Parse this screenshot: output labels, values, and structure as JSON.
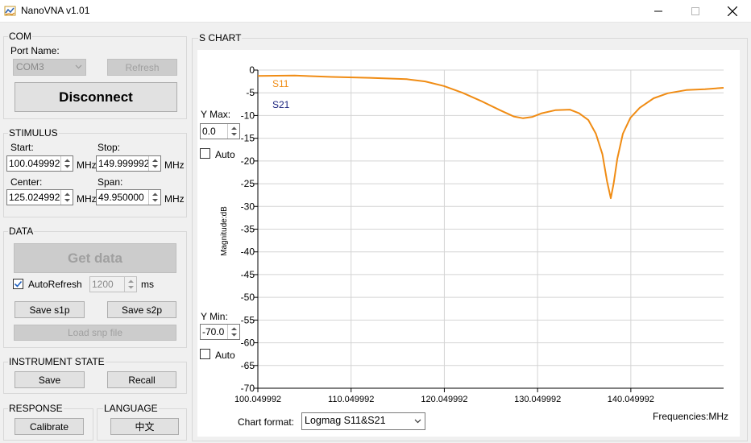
{
  "window": {
    "title": "NanoVNA v1.01"
  },
  "com": {
    "group_title": "COM",
    "port_label": "Port Name:",
    "port_value": "COM3",
    "refresh_label": "Refresh",
    "disconnect_label": "Disconnect"
  },
  "stimulus": {
    "group_title": "STIMULUS",
    "start_label": "Start:",
    "start_value": "100.049992",
    "stop_label": "Stop:",
    "stop_value": "149.999992",
    "center_label": "Center:",
    "center_value": "125.024992",
    "span_label": "Span:",
    "span_value": "49.950000",
    "unit": "MHz"
  },
  "data_group": {
    "group_title": "DATA",
    "get_data_label": "Get data",
    "autorefresh_label": "AutoRefresh",
    "autorefresh_checked": true,
    "interval_value": "1200",
    "interval_unit": "ms",
    "save_s1p_label": "Save s1p",
    "save_s2p_label": "Save s2p",
    "load_snp_label": "Load snp file"
  },
  "instrument_state": {
    "group_title": "INSTRUMENT STATE",
    "save_label": "Save",
    "recall_label": "Recall"
  },
  "response": {
    "group_title": "RESPONSE",
    "calibrate_label": "Calibrate"
  },
  "language": {
    "group_title": "LANGUAGE",
    "button_label": "中文"
  },
  "s_chart": {
    "group_title": "S CHART",
    "ymax_label": "Y Max:",
    "ymax_value": "0.0",
    "ymax_auto_label": "Auto",
    "ymin_label": "Y Min:",
    "ymin_value": "-70.0",
    "ymin_auto_label": "Auto",
    "chart_format_label": "Chart format:",
    "chart_format_value": "Logmag S11&S21",
    "frequency_units_label": "Frequencies:MHz"
  },
  "colors": {
    "s11": "#f08c14",
    "s21": "#1a237e",
    "window_bg": "#f0f0f0"
  },
  "icons": {
    "app": "nanovna-app-icon",
    "minimize": "minimize-icon",
    "maximize": "maximize-icon",
    "close": "close-icon"
  },
  "chart_data": {
    "type": "line",
    "ylabel": "Magnitude:dB",
    "xlabel": "Frequencies:MHz",
    "ylim": [
      -70,
      0
    ],
    "xlim": [
      100.049992,
      149.999992
    ],
    "y_ticks": [
      "0",
      "-5",
      "-10",
      "-15",
      "-20",
      "-25",
      "-30",
      "-35",
      "-40",
      "-45",
      "-50",
      "-55",
      "-60",
      "-65",
      "-70"
    ],
    "x_ticks": [
      "100.049992",
      "110.049992",
      "120.049992",
      "130.049992",
      "140.049992"
    ],
    "grid": true,
    "legend": [
      "S11",
      "S21"
    ],
    "series": [
      {
        "name": "S11",
        "x": [
          100.05,
          104,
          108,
          112,
          116,
          118,
          120,
          122,
          124,
          126,
          127.5,
          128.5,
          129.5,
          130.5,
          132,
          133.5,
          134.5,
          135.5,
          136.3,
          137,
          137.5,
          137.9,
          138.2,
          138.6,
          139.2,
          140,
          141,
          142.5,
          144,
          146,
          148,
          150
        ],
        "y": [
          -1.3,
          -1.2,
          -1.5,
          -1.7,
          -2.0,
          -2.5,
          -3.5,
          -5.0,
          -6.8,
          -8.8,
          -10.2,
          -10.6,
          -10.3,
          -9.5,
          -8.8,
          -8.7,
          -9.5,
          -11.0,
          -14.0,
          -18.5,
          -24.5,
          -28.2,
          -25.0,
          -19.5,
          -14.0,
          -10.5,
          -8.3,
          -6.2,
          -5.1,
          -4.4,
          -4.2,
          -3.9
        ]
      },
      {
        "name": "S21",
        "x": [],
        "y": []
      }
    ]
  }
}
